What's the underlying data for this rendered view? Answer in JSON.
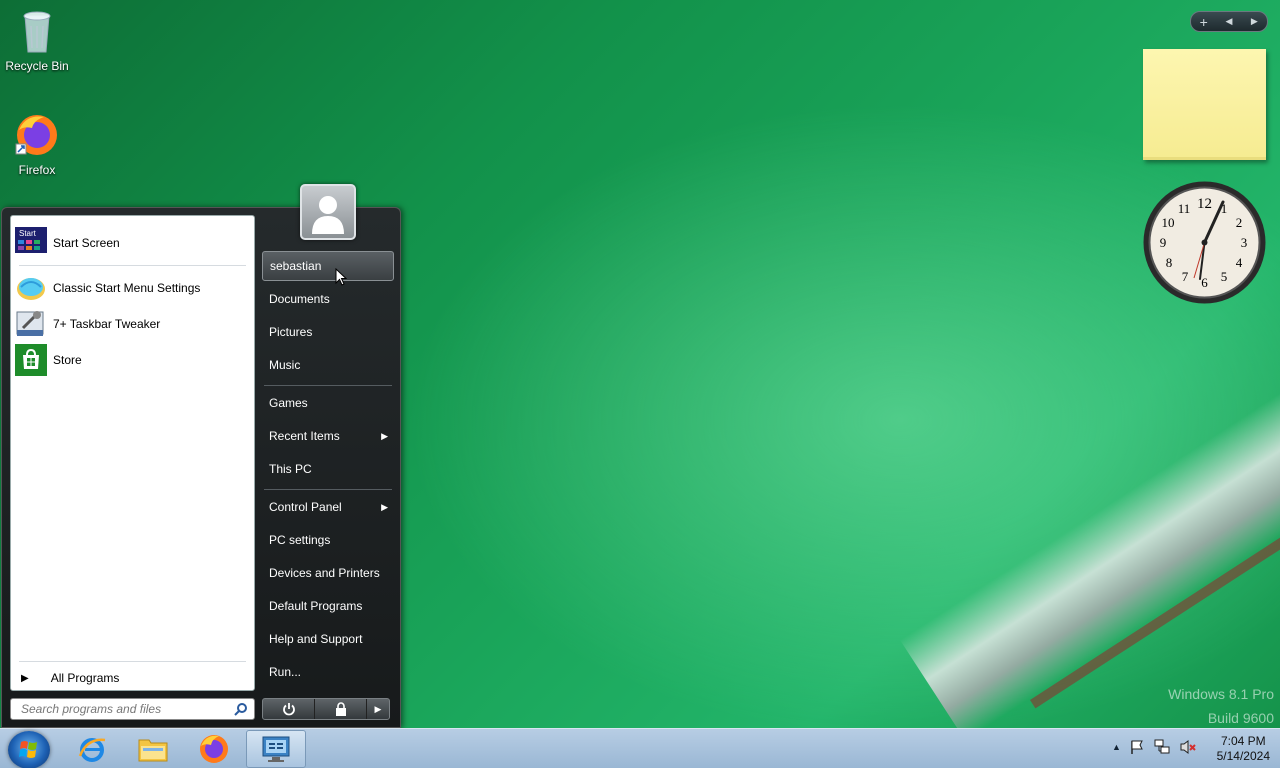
{
  "desktop": {
    "icons": [
      {
        "label": "Recycle Bin",
        "icon": "recycle-bin-icon"
      },
      {
        "label": "Firefox",
        "icon": "firefox-icon"
      }
    ],
    "watermark": {
      "line1": "Windows 8.1 Pro",
      "line2": "Build 9600"
    }
  },
  "gadgets": {
    "bar": {
      "add": "+",
      "prev": "◀",
      "next": "▶"
    },
    "clock": {
      "numbers": [
        "12",
        "1",
        "2",
        "3",
        "4",
        "5",
        "6",
        "7",
        "8",
        "9",
        "10",
        "11"
      ]
    }
  },
  "start_menu": {
    "pinned": [
      {
        "label": "Start Screen",
        "icon": "start-screen-icon",
        "icon_text": "Start"
      },
      {
        "label": "Classic Start Menu Settings",
        "icon": "classic-shell-icon"
      },
      {
        "label": "7+ Taskbar Tweaker",
        "icon": "taskbar-tweaker-icon"
      },
      {
        "label": "Store",
        "icon": "store-icon"
      }
    ],
    "all_programs": "All Programs",
    "search_placeholder": "Search programs and files",
    "right": {
      "user": "sebastian",
      "documents": "Documents",
      "pictures": "Pictures",
      "music": "Music",
      "games": "Games",
      "recent_items": "Recent Items",
      "this_pc": "This PC",
      "control_panel": "Control Panel",
      "pc_settings": "PC settings",
      "devices_printers": "Devices and Printers",
      "default_programs": "Default Programs",
      "help_support": "Help and Support",
      "run": "Run..."
    }
  },
  "taskbar": {
    "buttons": [
      {
        "name": "internet-explorer",
        "icon": "internet-explorer-icon"
      },
      {
        "name": "file-explorer",
        "icon": "folder-icon"
      },
      {
        "name": "firefox",
        "icon": "firefox-icon"
      },
      {
        "name": "control-panel",
        "icon": "control-panel-icon"
      }
    ],
    "clock_time": "7:04 PM",
    "clock_date": "5/14/2024"
  }
}
